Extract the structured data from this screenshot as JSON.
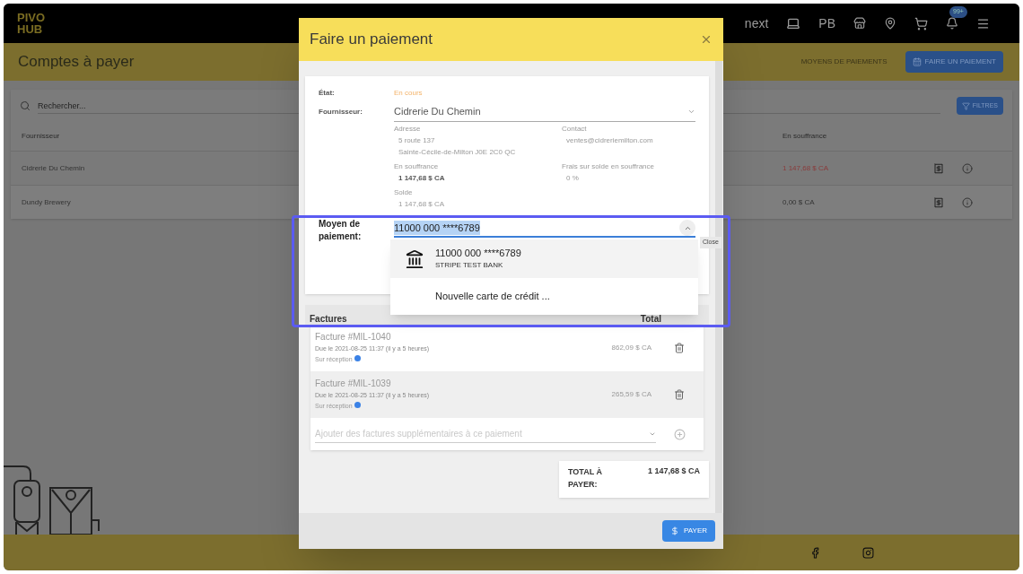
{
  "header": {
    "logo": [
      "PIVO",
      "HUB"
    ],
    "nav_label": "next",
    "initials": "PB",
    "notification_badge": "99+"
  },
  "page": {
    "title": "Comptes à payer",
    "link_action": "MOYENS DE PAIEMENTS",
    "primary_action": "FAIRE UN PAIEMENT"
  },
  "table": {
    "search_placeholder": "Rechercher...",
    "filter_button": "FILTRES",
    "columns": [
      "Fournisseur",
      "En souffrance"
    ],
    "rows": [
      {
        "supplier": "Cidrerie Du Chemin",
        "outstanding": "1 147,68 $ CA",
        "overdue": true
      },
      {
        "supplier": "Dundy Brewery",
        "outstanding": "0,00 $ CA",
        "overdue": false
      }
    ]
  },
  "modal": {
    "title": "Faire un paiement",
    "status": {
      "label": "État:",
      "value": "En cours"
    },
    "supplier": {
      "label": "Fournisseur:",
      "value": "Cidrerie Du Chemin"
    },
    "details": [
      {
        "label": "Adresse",
        "lines": [
          "5 route 137",
          "Sainte-Cécile-de-Milton J0E 2C0 QC"
        ],
        "bold": false
      },
      {
        "label": "Contact",
        "lines": [
          "ventes@cidreriemilton.com"
        ],
        "bold": false
      },
      {
        "label": "En souffrance",
        "lines": [
          "1 147,68 $ CA"
        ],
        "bold": true
      },
      {
        "label": "Frais sur solde en souffrance",
        "lines": [
          "0 %"
        ],
        "bold": false
      },
      {
        "label": "Solde",
        "lines": [
          "1 147,68 $ CA"
        ],
        "bold": false
      }
    ],
    "payment": {
      "label": "Moyen de paiement:",
      "value": "11000 000 ****6789",
      "tooltip": "Close",
      "options": [
        {
          "kind": "bank",
          "label": "11000 000 ****6789",
          "sublabel": "STRIPE TEST BANK",
          "selected": true
        },
        {
          "kind": "new",
          "label": "Nouvelle carte de crédit ...",
          "selected": false
        }
      ]
    },
    "invoices": {
      "title": "Factures",
      "total_header": "Total",
      "items": [
        {
          "number": "Facture #MIL-1040",
          "due": "Due le 2021-08-25 11:37 (il y a 5 heures)",
          "terms": "Sur réception",
          "amount": "862,09 $ CA",
          "hovered": false
        },
        {
          "number": "Facture #MIL-1039",
          "due": "Due le 2021-08-25 11:37 (il y a 5 heures)",
          "terms": "Sur réception",
          "amount": "265,59 $ CA",
          "hovered": true
        }
      ],
      "add_placeholder": "Ajouter des factures supplémentaires à ce paiement"
    },
    "total": {
      "label": "TOTAL À PAYER:",
      "value": "1 147,68 $ CA"
    },
    "pay_button": "PAYER"
  }
}
